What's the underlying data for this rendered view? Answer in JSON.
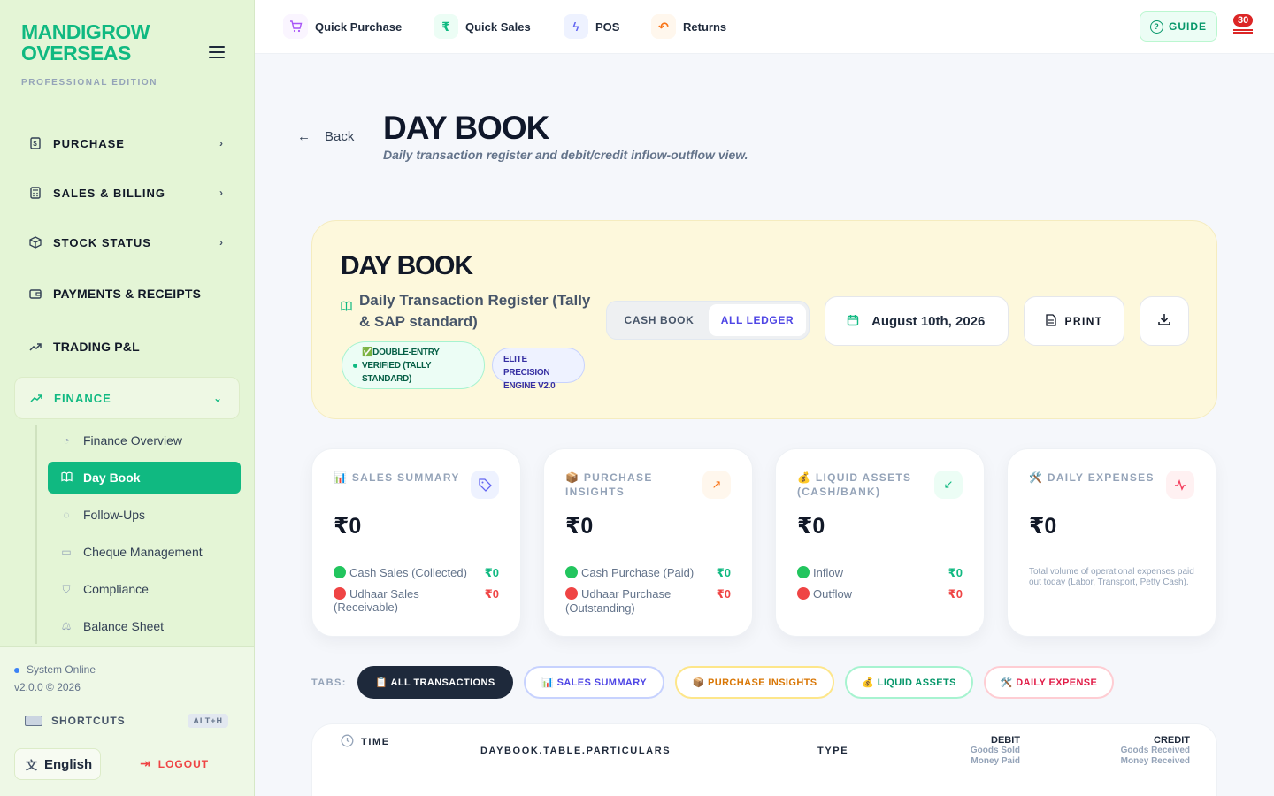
{
  "brand": {
    "name": "MANDIGROW OVERSEAS",
    "edition": "PROFESSIONAL EDITION"
  },
  "sidebar": {
    "items": [
      {
        "label": "PURCHASE"
      },
      {
        "label": "SALES & BILLING"
      },
      {
        "label": "STOCK STATUS"
      },
      {
        "label": "PAYMENTS & RECEIPTS"
      },
      {
        "label": "TRADING P&L"
      },
      {
        "label": "FINANCE"
      }
    ],
    "finance_sub": [
      {
        "label": "Finance Overview"
      },
      {
        "label": "Day Book"
      },
      {
        "label": "Follow-Ups"
      },
      {
        "label": "Cheque Management"
      },
      {
        "label": "Compliance"
      },
      {
        "label": "Balance Sheet"
      }
    ],
    "status": "System Online",
    "version": "v2.0.0 © 2026",
    "shortcuts_label": "SHORTCUTS",
    "shortcuts_key": "ALT+H",
    "language": "English",
    "logout": "LOGOUT"
  },
  "topbar": {
    "quick": [
      {
        "label": "Quick Purchase"
      },
      {
        "label": "Quick Sales"
      },
      {
        "label": "POS"
      },
      {
        "label": "Returns"
      }
    ],
    "guide": "GUIDE",
    "notifications": "30"
  },
  "header": {
    "back": "Back",
    "title": "DAY BOOK",
    "subtitle": "Daily transaction register and debit/credit inflow-outflow view."
  },
  "hero": {
    "title": "DAY BOOK",
    "description": "Daily Transaction Register (Tally & SAP standard)",
    "badge_verified": "✅DOUBLE-ENTRY VERIFIED (TALLY STANDARD)",
    "badge_engine": "ELITE PRECISION ENGINE V2.0",
    "toggle": [
      "CASH BOOK",
      "ALL LEDGER"
    ],
    "date": "August 10th, 2026",
    "print": "PRINT"
  },
  "cards": [
    {
      "title": "📊 SALES SUMMARY",
      "value": "₹0",
      "rows": [
        {
          "label": "Cash Sales (Collected)",
          "value": "₹0"
        },
        {
          "label": "Udhaar Sales (Receivable)",
          "value": "₹0"
        }
      ]
    },
    {
      "title": "📦 PURCHASE INSIGHTS",
      "value": "₹0",
      "rows": [
        {
          "label": "Cash Purchase (Paid)",
          "value": "₹0"
        },
        {
          "label": "Udhaar Purchase (Outstanding)",
          "value": "₹0"
        }
      ]
    },
    {
      "title": "💰 LIQUID ASSETS (CASH/BANK)",
      "value": "₹0",
      "rows": [
        {
          "label": "Inflow",
          "value": "₹0"
        },
        {
          "label": "Outflow",
          "value": "₹0"
        }
      ]
    },
    {
      "title": "🛠️ DAILY EXPENSES",
      "value": "₹0",
      "note": "Total volume of operational expenses paid out today (Labor, Transport, Petty Cash)."
    }
  ],
  "tabs": {
    "label": "TABS:",
    "items": [
      "📋 ALL TRANSACTIONS",
      "📊 SALES SUMMARY",
      "📦 PURCHASE INSIGHTS",
      "💰 LIQUID ASSETS",
      "🛠️ DAILY EXPENSE"
    ]
  },
  "table": {
    "time": "TIME",
    "particulars": "DAYBOOK.TABLE.PARTICULARS",
    "type": "TYPE",
    "debit": "DEBIT",
    "debit_sub1": "Goods Sold",
    "debit_sub2": "Money Paid",
    "credit": "CREDIT",
    "credit_sub1": "Goods Received",
    "credit_sub2": "Money Received"
  },
  "colors": {
    "accent": "#10b981",
    "sidebar_bg": "#e4f5d6",
    "hero_bg": "#fdf8dc",
    "indigo": "#4f46e5",
    "danger": "#ef4444"
  }
}
